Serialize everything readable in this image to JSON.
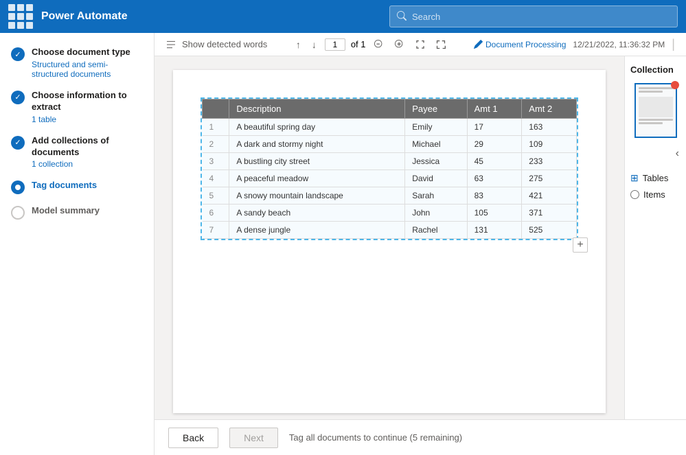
{
  "topnav": {
    "logo": "Power Automate",
    "search_placeholder": "Search"
  },
  "doc_toolbar": {
    "show_words_label": "Show detected words",
    "edit_label": "Document Processing",
    "edit_date": "12/21/2022, 11:36:32 PM",
    "page_current": "1",
    "page_total": "of 1"
  },
  "sidebar": {
    "steps": [
      {
        "id": "step1",
        "status": "completed",
        "title": "Choose document type",
        "subtitle": "Structured and semi-structured documents"
      },
      {
        "id": "step2",
        "status": "completed",
        "title": "Choose information to extract",
        "subtitle": "1 table"
      },
      {
        "id": "step3",
        "status": "completed",
        "title": "Add collections of documents",
        "subtitle": "1 collection"
      },
      {
        "id": "step4",
        "status": "active",
        "title": "Tag documents",
        "subtitle": ""
      },
      {
        "id": "step5",
        "status": "inactive",
        "title": "Model summary",
        "subtitle": ""
      }
    ]
  },
  "document_table": {
    "headers": [
      "",
      "Description",
      "Payee",
      "Amt 1",
      "Amt 2"
    ],
    "rows": [
      [
        "1",
        "A beautiful spring day",
        "Emily",
        "17",
        "163"
      ],
      [
        "2",
        "A dark and stormy night",
        "Michael",
        "29",
        "109"
      ],
      [
        "3",
        "A bustling city street",
        "Jessica",
        "45",
        "233"
      ],
      [
        "4",
        "A peaceful meadow",
        "David",
        "63",
        "275"
      ],
      [
        "5",
        "A snowy mountain landscape",
        "Sarah",
        "83",
        "421"
      ],
      [
        "6",
        "A sandy beach",
        "John",
        "105",
        "371"
      ],
      [
        "7",
        "A dense jungle",
        "Rachel",
        "131",
        "525"
      ]
    ]
  },
  "right_panel": {
    "title": "Collection",
    "options": [
      {
        "label": "Tables",
        "selected": true
      },
      {
        "label": "Items",
        "selected": false
      }
    ]
  },
  "bottom_bar": {
    "back_label": "Back",
    "next_label": "Next",
    "message": "Tag all documents to continue (5 remaining)"
  }
}
